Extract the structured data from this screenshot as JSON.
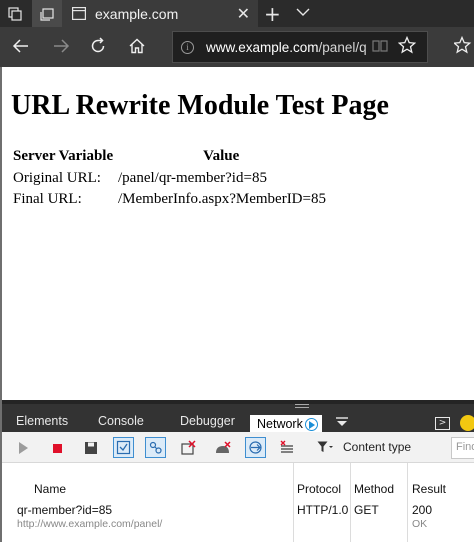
{
  "browser": {
    "tab_title": "example.com",
    "address": {
      "host": "www.example.com",
      "path": "/panel/qr"
    }
  },
  "page": {
    "heading": "URL Rewrite Module Test Page",
    "columns": {
      "variable": "Server Variable",
      "value": "Value"
    },
    "rows": [
      {
        "name": "Original URL:",
        "value": "/panel/qr-member?id=85"
      },
      {
        "name": "Final URL:",
        "value": "/MemberInfo.aspx?MemberID=85"
      }
    ]
  },
  "devtools": {
    "tabs": {
      "elements": "Elements",
      "console": "Console",
      "debugger": "Debugger",
      "network": "Network"
    },
    "toolbar": {
      "content_type": "Content type",
      "find_placeholder": "Find"
    },
    "network": {
      "headers": {
        "name": "Name",
        "protocol": "Protocol",
        "method": "Method",
        "result": "Result"
      },
      "requests": [
        {
          "name": "qr-member?id=85",
          "url": "http://www.example.com/panel/",
          "protocol": "HTTP/1.0",
          "method": "GET",
          "status": "200",
          "status_text": "OK"
        }
      ]
    }
  },
  "colors": {
    "chrome_dark": "#2b2b2b",
    "accent": "#1a8fd8",
    "stop_red": "#e0102a"
  }
}
